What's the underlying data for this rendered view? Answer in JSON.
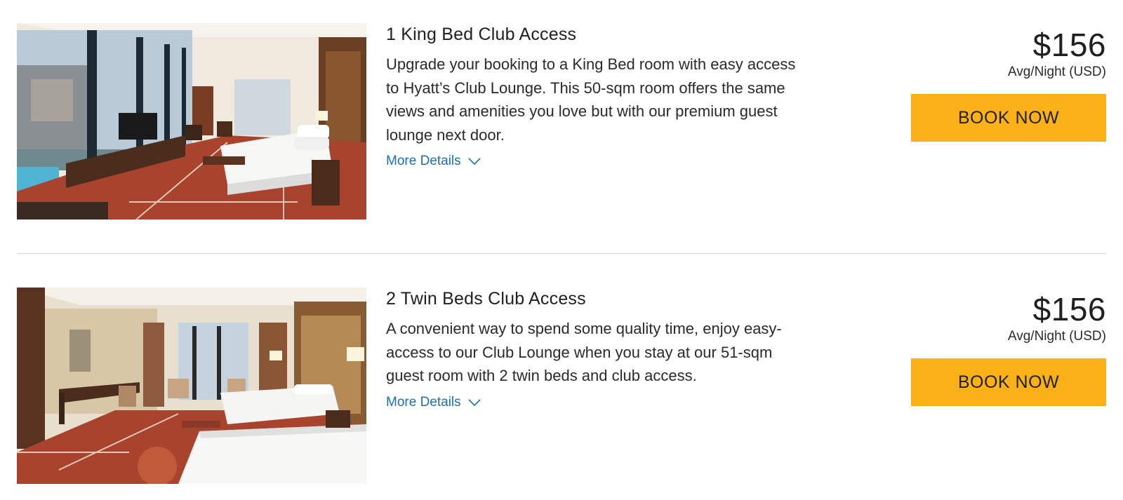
{
  "rooms": [
    {
      "title": "1 King Bed Club Access",
      "description": "Upgrade your booking to a King Bed room with easy access to Hyatt’s Club Lounge. This 50-sqm room offers the same views and amenities you love but with our premium guest lounge next door.",
      "more_details_label": "More Details",
      "price": "$156",
      "price_note": "Avg/Night (USD)",
      "book_label": "BOOK NOW",
      "photo_icon": "room-photo-king"
    },
    {
      "title": "2 Twin Beds Club Access",
      "description": "A convenient way to spend some quality time, enjoy easy-access to our Club Lounge when you stay at our 51-sqm guest room with 2 twin beds and club access.",
      "more_details_label": "More Details",
      "price": "$156",
      "price_note": "Avg/Night (USD)",
      "book_label": "BOOK NOW",
      "photo_icon": "room-photo-twin"
    }
  ],
  "colors": {
    "accent_button": "#fbb117",
    "link": "#1d6fae",
    "divider": "#d5d5d5"
  }
}
